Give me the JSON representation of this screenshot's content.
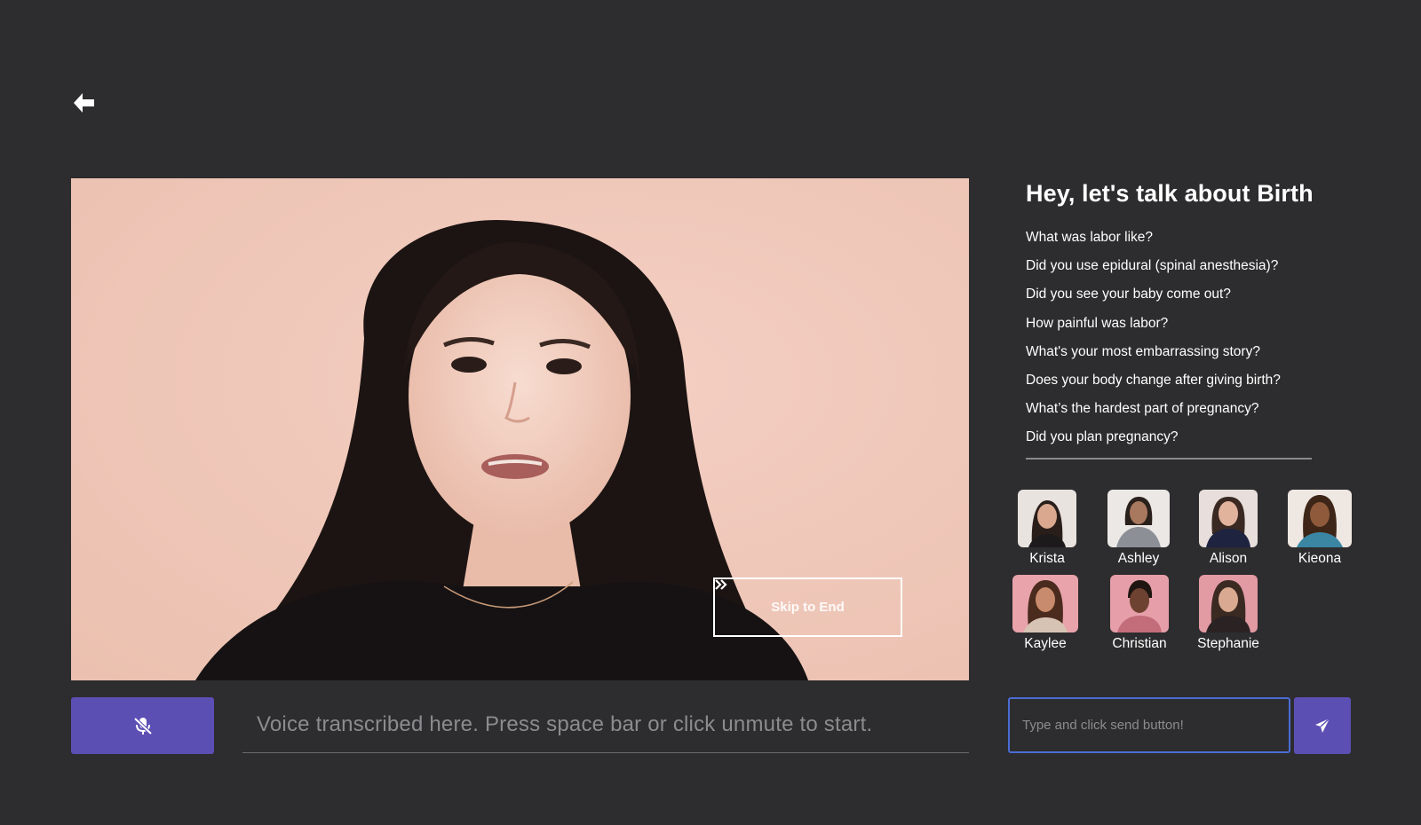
{
  "nav": {
    "back_icon": "arrow-left-icon"
  },
  "video": {
    "skip_label": "Skip to End",
    "skip_icon": "double-chevron-right-icon",
    "background_color": "#f3c8b9"
  },
  "controls": {
    "mute_icon": "microphone-slash-icon",
    "transcript_text": "Voice transcribed here. Press space bar or click unmute to start.",
    "chat_placeholder": "Type and click send button!",
    "send_icon": "paper-plane-icon",
    "accent_color": "#5c4fb4",
    "input_border_color": "#4a6cd4"
  },
  "panel": {
    "title": "Hey, let's talk about Birth",
    "questions": [
      "What was labor like?",
      "Did you use epidural (spinal anesthesia)?",
      "Did you see your baby come out?",
      "How painful was labor?",
      "What's your most embarrassing story?",
      "Does your body change after giving birth?",
      "What’s the hardest part of pregnancy?",
      "Did you plan pregnancy?"
    ]
  },
  "people": [
    {
      "name": "Krista"
    },
    {
      "name": "Ashley"
    },
    {
      "name": "Alison"
    },
    {
      "name": "Kieona"
    },
    {
      "name": "Kaylee"
    },
    {
      "name": "Christian"
    },
    {
      "name": "Stephanie"
    }
  ]
}
